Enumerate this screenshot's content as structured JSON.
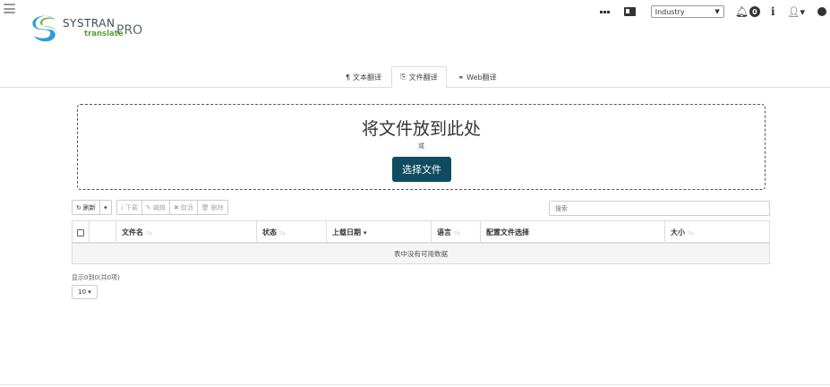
{
  "header": {
    "logo": {
      "brand": "SYSTRAN",
      "subbrand": "translate",
      "pro": "PRO"
    },
    "industry_select": {
      "value": "Industry"
    },
    "notifications_count": "0"
  },
  "tabs": [
    {
      "label": "文本翻译",
      "icon": "paragraph-icon"
    },
    {
      "label": "文件翻译",
      "icon": "file-icon"
    },
    {
      "label": "Web翻译",
      "icon": "link-icon"
    }
  ],
  "dropzone": {
    "title": "将文件放到此处",
    "or": "或",
    "button": "选择文件"
  },
  "toolbar": {
    "refresh": "刷新",
    "download": "下载",
    "edit": "编辑",
    "cancel": "取消",
    "delete": "删除"
  },
  "search": {
    "placeholder": "搜索"
  },
  "table": {
    "columns": [
      "文件名",
      "状态",
      "上载日期",
      "语言",
      "配置文件选择",
      "大小"
    ],
    "empty_message": "表中没有可用数据"
  },
  "footer": {
    "info": "显示0到0(共0项)",
    "page_size": "10"
  },
  "colors": {
    "primary_button": "#0f4c61",
    "logo_green": "#5aa133"
  }
}
